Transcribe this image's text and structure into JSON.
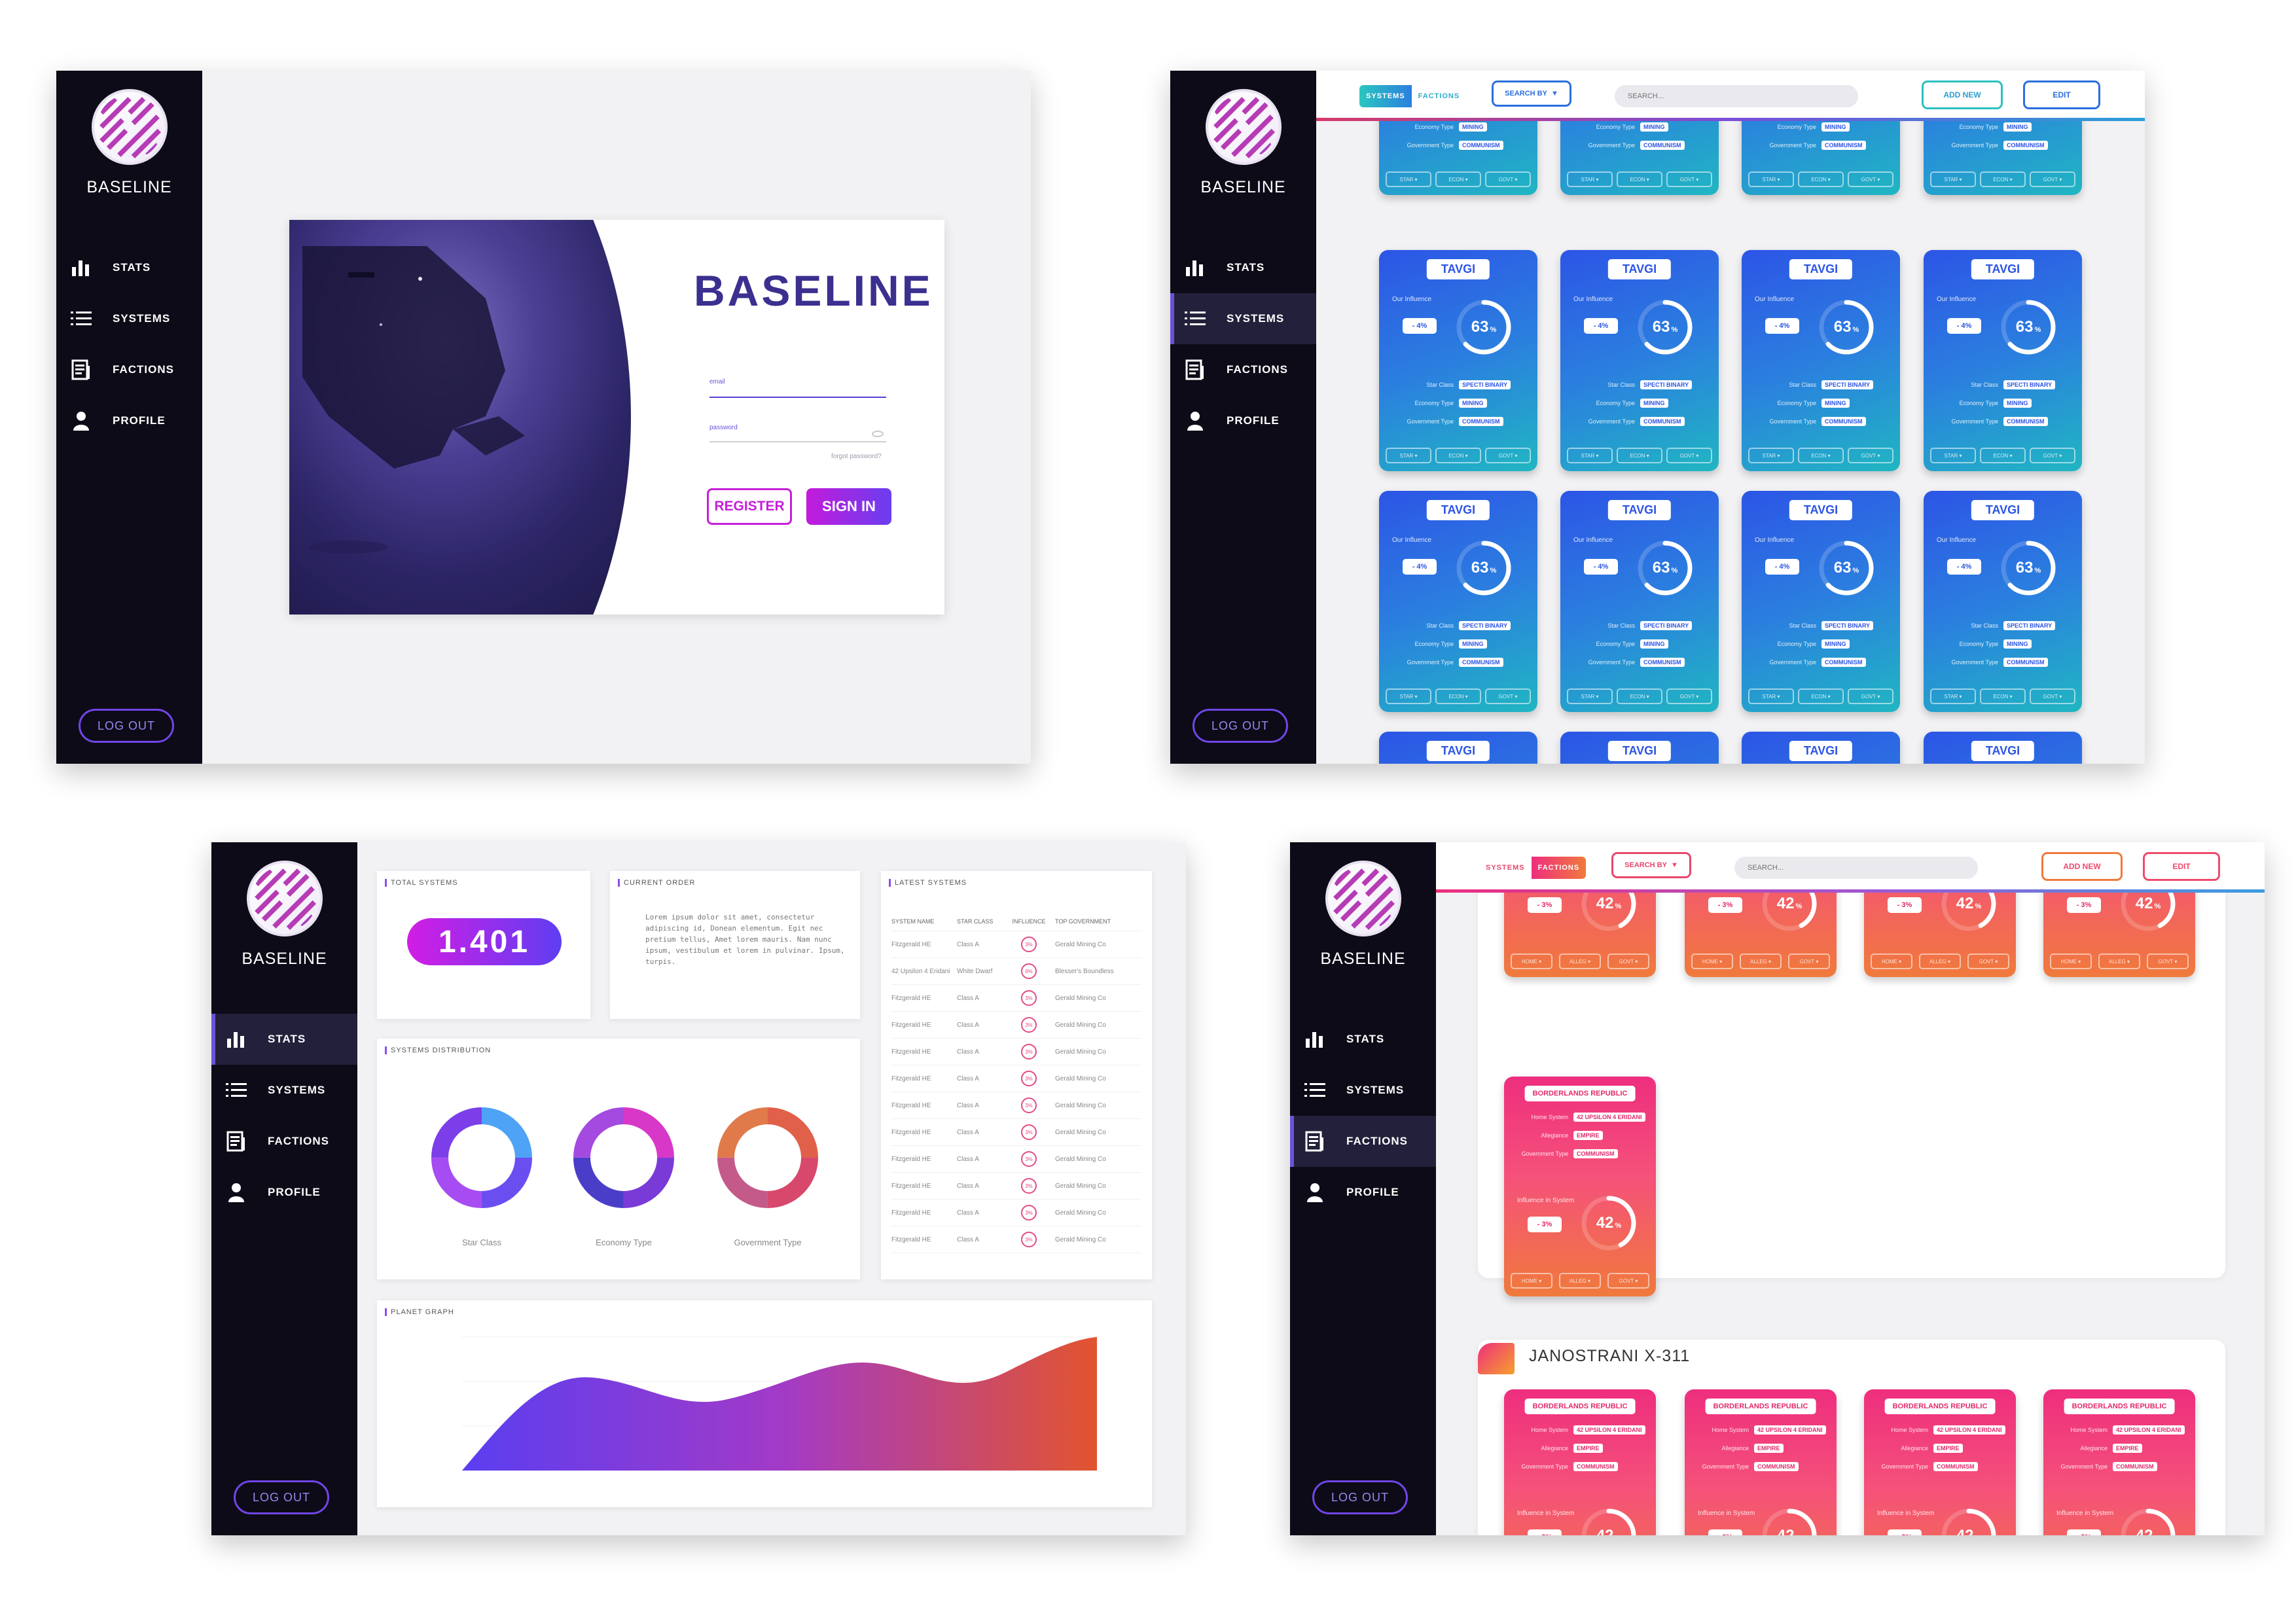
{
  "sidebar": {
    "brand": "BASELINE",
    "items": [
      {
        "label": "STATS"
      },
      {
        "label": "SYSTEMS"
      },
      {
        "label": "FACTIONS"
      },
      {
        "label": "PROFILE"
      }
    ],
    "logout": "LOG OUT"
  },
  "login": {
    "brand": "BASELINE",
    "email_label": "email",
    "password_label": "password",
    "forgot": "forgot password?",
    "register": "REGISTER",
    "signin": "SIGN IN"
  },
  "systems_bar": {
    "tabs": [
      "SYSTEMS",
      "FACTIONS"
    ],
    "search_by": "SEARCH BY",
    "search_placeholder": "SEARCH...",
    "add_new": "ADD NEW",
    "edit": "EDIT"
  },
  "system_card": {
    "title": "TAVGI",
    "subtitle": "Our Influence",
    "change": "- 4%",
    "percent": 63,
    "percent_unit": "%",
    "attrs": [
      {
        "k": "Star Class",
        "v": "SPECTI BINARY"
      },
      {
        "k": "Economy Type",
        "v": "MINING"
      },
      {
        "k": "Government Type",
        "v": "COMMUNISM"
      }
    ],
    "foot": [
      "STAR ▾",
      "ECON ▾",
      "GOVT ▾"
    ]
  },
  "stats": {
    "total_title": "TOTAL SYSTEMS",
    "total_value": "1.401",
    "order_title": "CURRENT ORDER",
    "order_text": "Lorem ipsum dolor sit amet, consectetur adipiscing id, Donean elementum. Egit nec pretium tellus, Amet lorem mauris. Nam nunc ipsum, vestibulum et lorem in pulvinar. Ipsum, turpis.",
    "latest_title": "LATEST SYSTEMS",
    "latest_headers": [
      "SYSTEM NAME",
      "STAR CLASS",
      "INFLUENCE",
      "TOP GOVERNMENT"
    ],
    "latest_rows": [
      [
        "Fitzgerald HE",
        "Class A",
        "3%",
        "Gerald Mining Co"
      ],
      [
        "42 Upsilon 4 Eridani",
        "White Dwarf",
        "6%",
        "Blesser's Boundless"
      ],
      [
        "Fitzgerald HE",
        "Class A",
        "3%",
        "Gerald Mining Co"
      ],
      [
        "Fitzgerald HE",
        "Class A",
        "3%",
        "Gerald Mining Co"
      ],
      [
        "Fitzgerald HE",
        "Class A",
        "3%",
        "Gerald Mining Co"
      ],
      [
        "Fitzgerald HE",
        "Class A",
        "3%",
        "Gerald Mining Co"
      ],
      [
        "Fitzgerald HE",
        "Class A",
        "3%",
        "Gerald Mining Co"
      ],
      [
        "Fitzgerald HE",
        "Class A",
        "3%",
        "Gerald Mining Co"
      ],
      [
        "Fitzgerald HE",
        "Class A",
        "3%",
        "Gerald Mining Co"
      ],
      [
        "Fitzgerald HE",
        "Class A",
        "3%",
        "Gerald Mining Co"
      ],
      [
        "Fitzgerald HE",
        "Class A",
        "3%",
        "Gerald Mining Co"
      ],
      [
        "Fitzgerald HE",
        "Class A",
        "3%",
        "Gerald Mining Co"
      ]
    ],
    "dist_title": "SYSTEMS DISTRIBUTION",
    "donuts": [
      {
        "label": "Star Class",
        "colors": [
          "#4fa3f7",
          "#6a4ef0",
          "#a64cf2",
          "#7b3ee8"
        ]
      },
      {
        "label": "Economy Type",
        "colors": [
          "#d838c8",
          "#7a3ad8",
          "#4a3ec8",
          "#a44ae0"
        ]
      },
      {
        "label": "Government Type",
        "colors": [
          "#e0604a",
          "#d8486c",
          "#c45a8a",
          "#e07a4a"
        ]
      }
    ],
    "graph_title": "PLANET GRAPH"
  },
  "faction_card": {
    "title": "BORDERLANDS REPUBLIC",
    "attrs": [
      {
        "k": "Home System",
        "v": "42 UPSILON 4 ERIDANI"
      },
      {
        "k": "Allegiance",
        "v": "EMPIRE"
      },
      {
        "k": "Government Type",
        "v": "COMMUNISM"
      }
    ],
    "subtitle": "Influence in System",
    "change": "- 3%",
    "percent": 42,
    "percent_unit": "%",
    "foot": [
      "HOME ▾",
      "ALLEG ▾",
      "GOVT ▾"
    ]
  },
  "factions_page": {
    "system_title": "JANOSTRANI X-311"
  }
}
